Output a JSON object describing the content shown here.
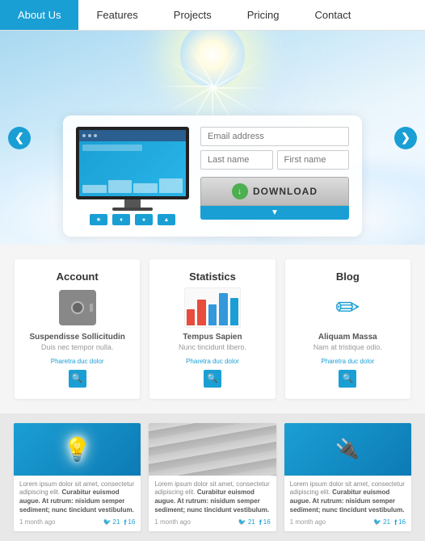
{
  "nav": {
    "items": [
      {
        "label": "About Us",
        "active": true
      },
      {
        "label": "Features",
        "active": false
      },
      {
        "label": "Projects",
        "active": false
      },
      {
        "label": "Pricing",
        "active": false
      },
      {
        "label": "Contact",
        "active": false
      }
    ]
  },
  "hero": {
    "email_placeholder": "Email address",
    "last_name_placeholder": "Last name",
    "first_name_placeholder": "First name",
    "download_label": "DOWNLOAD",
    "arrow_left": "❮",
    "arrow_right": "❯"
  },
  "features": [
    {
      "title": "Account",
      "subtitle": "Suspendisse Sollicitudin",
      "desc": "Duis nec tempor nulla.",
      "link": "Pharetra duc dolor",
      "icon": "safe"
    },
    {
      "title": "Statistics",
      "subtitle": "Tempus Sapien",
      "desc": "Nunc tincidunt libero.",
      "link": "Pharetra duc dolor",
      "icon": "chart"
    },
    {
      "title": "Blog",
      "subtitle": "Aliquam Massa",
      "desc": "Nam at tristique odio.",
      "link": "Pharetra duc dolor",
      "icon": "pencil"
    }
  ],
  "blog": {
    "cards": [
      {
        "type": "bulb",
        "text_intro": "Lorem ipsum dolor sit amet, consectetur adipiscing elit.",
        "text_body": "Curabitur euismod augue. At rutrum: nisidum semper sediment; nunc tincidunt vestibulum.",
        "date": "1 month ago",
        "twitter": "21",
        "facebook": "16"
      },
      {
        "type": "stripes",
        "text_intro": "Lorem ipsum dolor sit amet, consectetur adipiscing elit.",
        "text_body": "Curabitur euismod augue. At rutrum: nisidum semper sediment; nunc tincidunt vestibulum.",
        "date": "1 month ago",
        "twitter": "21",
        "facebook": "16"
      },
      {
        "type": "plug",
        "text_intro": "Lorem ipsum dolor sit amet, consectetur adipiscing elit.",
        "text_body": "Curabitur euismod augue. At rutrum: nisidum semper sediment; nunc tincidunt vestibulum.",
        "date": "1 month ago",
        "twitter": "21",
        "facebook": "16"
      }
    ]
  },
  "icons": {
    "search": "🔍",
    "download_arrow": "▼",
    "twitter": "🐦",
    "facebook": "f"
  }
}
